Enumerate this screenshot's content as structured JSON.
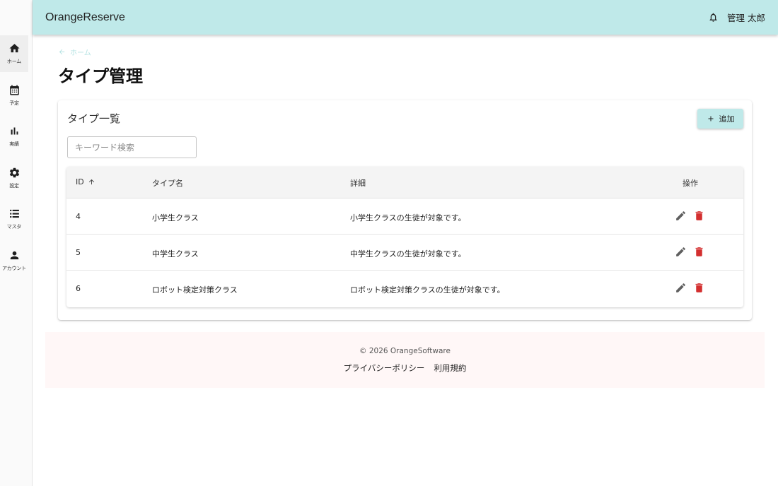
{
  "app": {
    "title": "OrangeReserve"
  },
  "header": {
    "user_name": "管理 太郎",
    "bell_icon": "bell-icon"
  },
  "sidebar": {
    "items": [
      {
        "label": "ホーム",
        "icon": "home-icon"
      },
      {
        "label": "予定",
        "icon": "calendar-icon"
      },
      {
        "label": "実績",
        "icon": "bar-chart-icon"
      },
      {
        "label": "設定",
        "icon": "gear-icon"
      },
      {
        "label": "マスタ",
        "icon": "list-icon"
      },
      {
        "label": "アカウント",
        "icon": "person-icon"
      }
    ]
  },
  "breadcrumb": {
    "label": "ホーム",
    "icon": "arrow-left-icon"
  },
  "page": {
    "title": "タイプ管理"
  },
  "card": {
    "title": "タイプ一覧",
    "add_label": "追加",
    "search_placeholder": "キーワード検索"
  },
  "table": {
    "headers": {
      "id": "ID",
      "name": "タイプ名",
      "detail": "詳細",
      "actions": "操作"
    },
    "sort": {
      "column": "id",
      "direction": "asc"
    },
    "rows": [
      {
        "id": "4",
        "name": "小学生クラス",
        "detail": "小学生クラスの生徒が対象です。"
      },
      {
        "id": "5",
        "name": "中学生クラス",
        "detail": "中学生クラスの生徒が対象です。"
      },
      {
        "id": "6",
        "name": "ロボット検定対策クラス",
        "detail": "ロボット検定対策クラスの生徒が対象です。"
      }
    ]
  },
  "footer": {
    "copyright": "© 2026 OrangeSoftware",
    "links": [
      "プライバシーポリシー",
      "利用規約"
    ]
  },
  "colors": {
    "accent": "#bfe9e9",
    "delete": "#d32f2f",
    "footer_bg": "#fff7f7"
  }
}
